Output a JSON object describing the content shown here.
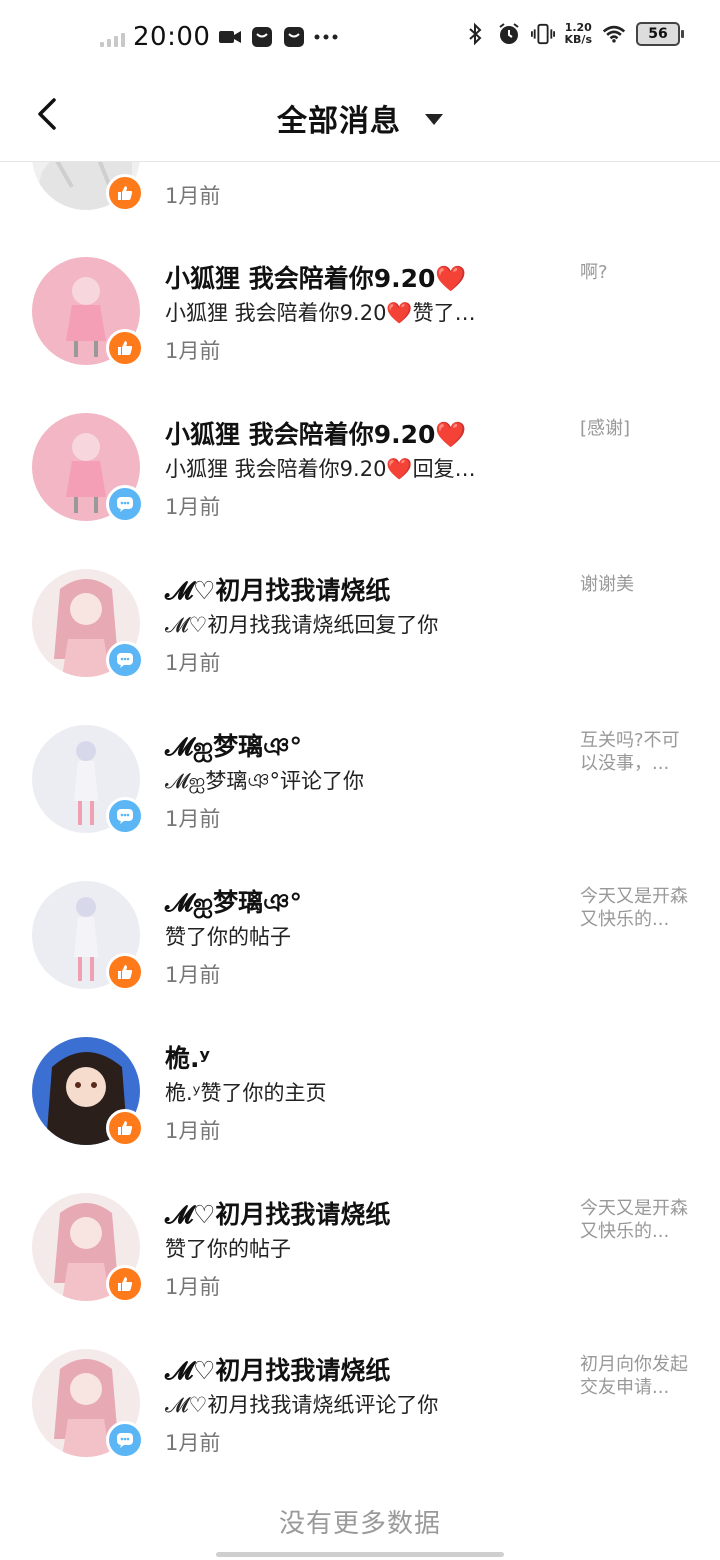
{
  "status_bar": {
    "time": "20:00",
    "net_speed_top": "1.20",
    "net_speed_unit": "KB/s",
    "battery": "56"
  },
  "header": {
    "title": "全部消息"
  },
  "notifications": [
    {
      "name": "",
      "desc": "",
      "time": "1月前",
      "preview": "",
      "type": "like"
    },
    {
      "name": "小狐狸    我会陪着你9.20❤️",
      "desc": "小狐狸    我会陪着你9.20❤️赞了…",
      "time": "1月前",
      "preview": "啊?",
      "type": "like"
    },
    {
      "name": "小狐狸    我会陪着你9.20❤️",
      "desc": "小狐狸    我会陪着你9.20❤️回复…",
      "time": "1月前",
      "preview": "[感谢]",
      "type": "comment"
    },
    {
      "name": "𝓜♡初月找我请烧纸",
      "desc": "𝓜♡初月找我请烧纸回复了你",
      "time": "1月前",
      "preview": "谢谢美",
      "type": "comment"
    },
    {
      "name": "𝓜ஐ梦璃ঞ°",
      "desc": "𝓜ஐ梦璃ঞ°评论了你",
      "time": "1月前",
      "preview": "互关吗?不可以没事，...",
      "type": "comment"
    },
    {
      "name": "𝓜ஐ梦璃ঞ°",
      "desc": "赞了你的帖子",
      "time": "1月前",
      "preview": "今天又是开森又快乐的...",
      "type": "like"
    },
    {
      "name": "桅.ʸ",
      "desc": "桅.ʸ赞了你的主页",
      "time": "1月前",
      "preview": "",
      "type": "like"
    },
    {
      "name": "𝓜♡初月找我请烧纸",
      "desc": "赞了你的帖子",
      "time": "1月前",
      "preview": "今天又是开森又快乐的...",
      "type": "like"
    },
    {
      "name": "𝓜♡初月找我请烧纸",
      "desc": "𝓜♡初月找我请烧纸评论了你",
      "time": "1月前",
      "preview": "初月向你发起交友申请...",
      "type": "comment"
    }
  ],
  "footer": {
    "no_more": "没有更多数据"
  },
  "colors": {
    "like_badge": "#ff7a1a",
    "comment_badge": "#5cb6f5"
  }
}
